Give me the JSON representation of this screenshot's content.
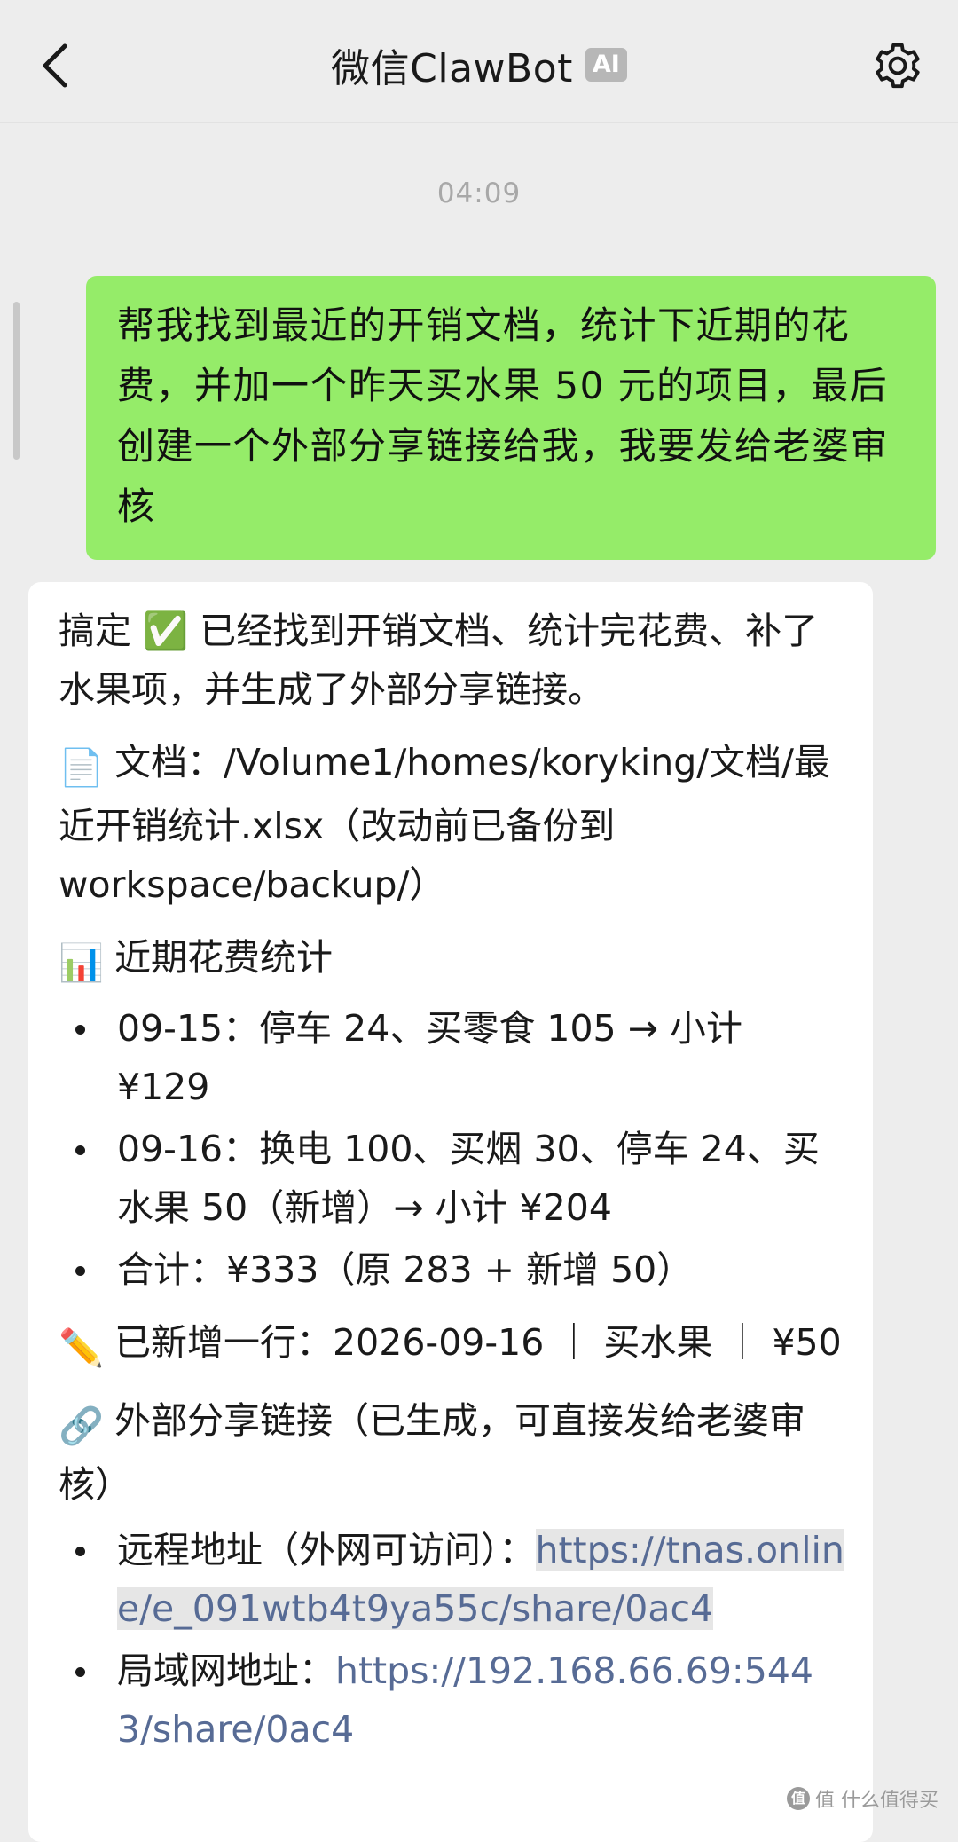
{
  "header": {
    "title": "微信ClawBot",
    "badge": "AI",
    "back_icon": "chevron-left-icon",
    "settings_icon": "gear-icon"
  },
  "timestamp": "04:09",
  "user_message": "帮我找到最近的开销文档，统计下近期的花费，并加一个昨天买水果 50 元的项目，最后创建一个外部分享链接给我，我要发给老婆审核",
  "bot_message": {
    "intro": "搞定 ✅ 已经找到开销文档、统计完花费、补了水果项，并生成了外部分享链接。",
    "doc_emoji": "📄",
    "doc_line": "文档：/Volume1/homes/koryking/文档/最近开销统计.xlsx（改动前已备份到 workspace/backup/）",
    "stats_emoji": "📊",
    "stats_title": "近期花费统计",
    "stats_items": [
      "09-15：停车 24、买零食 105 → 小计 ¥129",
      "09-16：换电 100、买烟 30、停车 24、买水果 50（新增）→ 小计 ¥204",
      "合计：¥333（原 283 + 新增 50）"
    ],
    "added_emoji": "✏️",
    "added_line": "已新增一行：2026-09-16 ｜ 买水果 ｜ ¥50",
    "link_emoji": "🔗",
    "link_title": "外部分享链接（已生成，可直接发给老婆审核）",
    "remote_label": "远程地址（外网可访问）：",
    "remote_url": "https://tnas.online/e_091wtb4t9ya55c/share/0ac4",
    "lan_label": "局域网地址：",
    "lan_url": "https://192.168.66.69:5443/share/0ac4"
  },
  "watermark": "值 什么值得买",
  "watermark_logo": "值"
}
